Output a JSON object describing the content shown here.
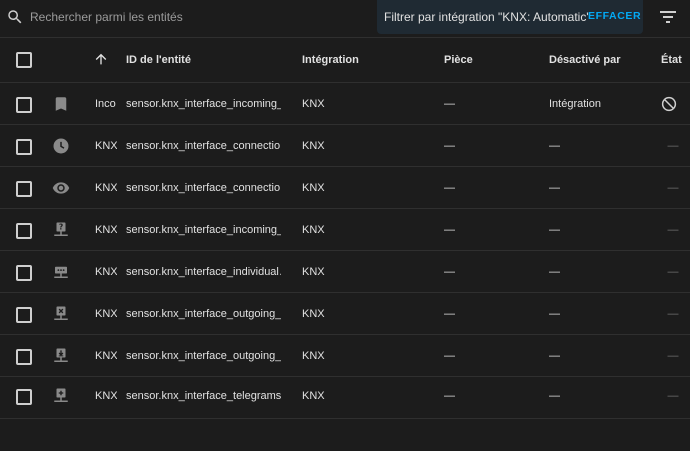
{
  "search": {
    "placeholder": "Rechercher parmi les entités"
  },
  "filter": {
    "label": "Filtrer par intégration \"KNX: Automatic\"",
    "clear_label": "EFFACER"
  },
  "columns": {
    "entity_id": "ID de l'entité",
    "integration": "Intégration",
    "area": "Pièce",
    "disabled_by": "Désactivé par",
    "status": "État"
  },
  "rows": [
    {
      "icon": "bookmark-icon",
      "name": "Inco",
      "entity_id": "sensor.knx_interface_incoming_…",
      "integration": "KNX",
      "area": "—",
      "disabled_by": "Intégration",
      "status": "disabled"
    },
    {
      "icon": "clock-icon",
      "name": "KNX",
      "entity_id": "sensor.knx_interface_connectio…",
      "integration": "KNX",
      "area": "—",
      "disabled_by": "—",
      "status": "—"
    },
    {
      "icon": "eye-icon",
      "name": "KNX",
      "entity_id": "sensor.knx_interface_connectio…",
      "integration": "KNX",
      "area": "—",
      "disabled_by": "—",
      "status": "—"
    },
    {
      "icon": "network-question-icon",
      "name": "KNX",
      "entity_id": "sensor.knx_interface_incoming_…",
      "integration": "KNX",
      "area": "—",
      "disabled_by": "—",
      "status": "—"
    },
    {
      "icon": "network-dots-icon",
      "name": "KNX",
      "entity_id": "sensor.knx_interface_individual…",
      "integration": "KNX",
      "area": "—",
      "disabled_by": "—",
      "status": "—"
    },
    {
      "icon": "network-close-icon",
      "name": "KNX",
      "entity_id": "sensor.knx_interface_outgoing_…",
      "integration": "KNX",
      "area": "—",
      "disabled_by": "—",
      "status": "—"
    },
    {
      "icon": "network-download-icon",
      "name": "KNX",
      "entity_id": "sensor.knx_interface_outgoing_…",
      "integration": "KNX",
      "area": "—",
      "disabled_by": "—",
      "status": "—"
    },
    {
      "icon": "network-plus-icon",
      "name": "KNX",
      "entity_id": "sensor.knx_interface_telegrams",
      "integration": "KNX",
      "area": "—",
      "disabled_by": "—",
      "status": "—"
    }
  ]
}
